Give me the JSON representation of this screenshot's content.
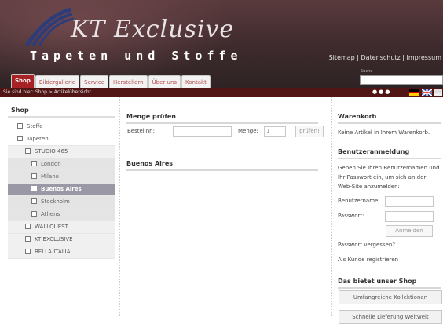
{
  "header": {
    "logo_text": "KT Exclusive",
    "tagline": "Tapeten und Stoffe",
    "top_links": [
      "Sitemap",
      "Datenschutz",
      "Impressum"
    ],
    "link_separator": " | ",
    "search_label": "Suche",
    "search_value": "",
    "tabs": [
      {
        "label": "Shop",
        "active": true
      },
      {
        "label": "Bildergallerie",
        "active": false
      },
      {
        "label": "Service",
        "active": false
      },
      {
        "label": "Herstellern",
        "active": false
      },
      {
        "label": "Über uns",
        "active": false
      },
      {
        "label": "Kontakt",
        "active": false
      }
    ],
    "accent_color": "#a82225",
    "breadcrumb": "Sie sind hier: Shop > Artikelübersicht"
  },
  "sidebar": {
    "title": "Shop",
    "items": [
      {
        "label": "Stoffe",
        "level": 1,
        "active": false
      },
      {
        "label": "Tapeten",
        "level": 1,
        "active": false
      },
      {
        "label": "STUDIO 465",
        "level": 2,
        "active": false
      },
      {
        "label": "London",
        "level": 3,
        "active": false
      },
      {
        "label": "Milano",
        "level": 3,
        "active": false
      },
      {
        "label": "Buenos Aires",
        "level": 3,
        "active": true
      },
      {
        "label": "Stockholm",
        "level": 3,
        "active": false
      },
      {
        "label": "Athens",
        "level": 3,
        "active": false
      },
      {
        "label": "WALLQUEST",
        "level": 2,
        "active": false
      },
      {
        "label": "KT EXCLUSIVE",
        "level": 2,
        "active": false
      },
      {
        "label": "BELLA ITALIA",
        "level": 2,
        "active": false
      }
    ]
  },
  "main": {
    "check_title": "Menge prüfen",
    "order_label": "Bestellnr.:",
    "order_value": "",
    "qty_label": "Menge:",
    "qty_value": "1",
    "check_button": "prüfen!",
    "category_title": "Buenos Aires"
  },
  "right": {
    "cart_title": "Warenkorb",
    "cart_text": "Keine Artikel in Ihrem Warenkorb.",
    "login_title": "Benutzeranmeldung",
    "login_text": "Geben Sie Ihren Benutzernamen und Ihr Passwort ein, um sich an der Web-Site anzumelden:",
    "username_label": "Benutzername:",
    "password_label": "Passwort:",
    "login_button": "Anmelden",
    "forgot_link": "Passwort vergessen?",
    "register_link": "Als Kunde registrieren",
    "shop_title": "Das bietet unser Shop",
    "features": [
      "Umfangreiche Kollektionen",
      "Schnelle Lieferung Weltweit"
    ]
  }
}
